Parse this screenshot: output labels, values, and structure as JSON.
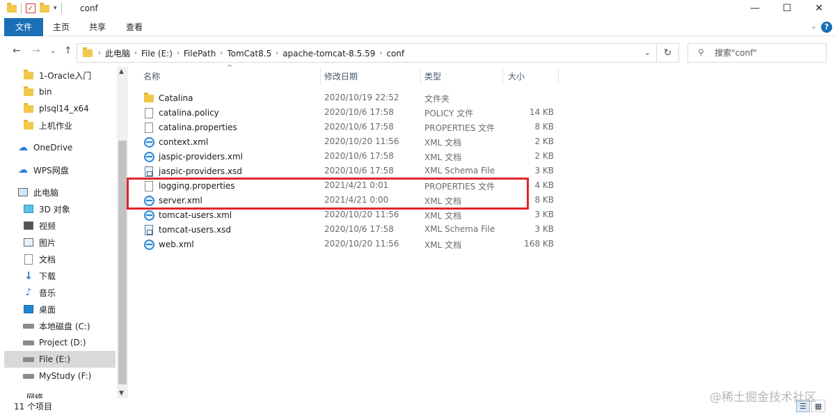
{
  "window": {
    "title": "conf",
    "minimize_glyph": "—",
    "maximize_glyph": "☐",
    "close_glyph": "✕"
  },
  "ribbon": {
    "tabs": [
      {
        "label": "文件",
        "active": true
      },
      {
        "label": "主页"
      },
      {
        "label": "共享"
      },
      {
        "label": "查看"
      }
    ],
    "expand_glyph": "⌄",
    "help_glyph": "?"
  },
  "navigation": {
    "back_glyph": "←",
    "forward_glyph": "→",
    "recent_glyph": "⌄",
    "up_glyph": "↑",
    "breadcrumbs": [
      "此电脑",
      "File (E:)",
      "FilePath",
      "TomCat8.5",
      "apache-tomcat-8.5.59",
      "conf"
    ],
    "crumb_separator": "›",
    "dropdown_glyph": "⌄",
    "refresh_glyph": "↻",
    "search_placeholder": "搜索\"conf\"",
    "search_icon_glyph": "⚲"
  },
  "nav_pane": {
    "items": [
      {
        "label": "1-Oracle入门",
        "icon": "folder-icon"
      },
      {
        "label": "bin",
        "icon": "folder-icon"
      },
      {
        "label": "plsql14_x64",
        "icon": "folder-icon"
      },
      {
        "label": "上机作业",
        "icon": "folder-icon"
      },
      {
        "label": "OneDrive",
        "icon": "onedrive-icon"
      },
      {
        "label": "WPS网盘",
        "icon": "wps-cloud-icon"
      },
      {
        "label": "此电脑",
        "icon": "this-pc-icon"
      },
      {
        "label": "3D 对象",
        "icon": "3d-objects-icon"
      },
      {
        "label": "视频",
        "icon": "video-icon"
      },
      {
        "label": "图片",
        "icon": "pictures-icon"
      },
      {
        "label": "文档",
        "icon": "documents-icon"
      },
      {
        "label": "下载",
        "icon": "downloads-icon"
      },
      {
        "label": "音乐",
        "icon": "music-icon"
      },
      {
        "label": "桌面",
        "icon": "desktop-icon"
      },
      {
        "label": "本地磁盘 (C:)",
        "icon": "drive-icon"
      },
      {
        "label": "Project (D:)",
        "icon": "drive-icon"
      },
      {
        "label": "File (E:)",
        "icon": "drive-icon",
        "selected": true
      },
      {
        "label": "MyStudy (F:)",
        "icon": "drive-icon"
      },
      {
        "label": "网络",
        "icon": "network-icon"
      }
    ],
    "scroll_up_glyph": "▲",
    "scroll_down_glyph": "▼"
  },
  "file_list": {
    "columns": {
      "name": "名称",
      "date": "修改日期",
      "type": "类型",
      "size": "大小"
    },
    "sort_glyph": "^",
    "rows": [
      {
        "name": "Catalina",
        "date": "2020/10/19 22:52",
        "type": "文件夹",
        "size": "",
        "icon": "folder-icon"
      },
      {
        "name": "catalina.policy",
        "date": "2020/10/6 17:58",
        "type": "POLICY 文件",
        "size": "14 KB",
        "icon": "file-icon"
      },
      {
        "name": "catalina.properties",
        "date": "2020/10/6 17:58",
        "type": "PROPERTIES 文件",
        "size": "8 KB",
        "icon": "file-icon"
      },
      {
        "name": "context.xml",
        "date": "2020/10/20 11:56",
        "type": "XML 文档",
        "size": "2 KB",
        "icon": "xml-icon"
      },
      {
        "name": "jaspic-providers.xml",
        "date": "2020/10/6 17:58",
        "type": "XML 文档",
        "size": "2 KB",
        "icon": "xml-icon"
      },
      {
        "name": "jaspic-providers.xsd",
        "date": "2020/10/6 17:58",
        "type": "XML Schema File",
        "size": "3 KB",
        "icon": "xsd-icon"
      },
      {
        "name": "logging.properties",
        "date": "2021/4/21 0:01",
        "type": "PROPERTIES 文件",
        "size": "4 KB",
        "icon": "file-icon"
      },
      {
        "name": "server.xml",
        "date": "2021/4/21 0:00",
        "type": "XML 文档",
        "size": "8 KB",
        "icon": "xml-icon"
      },
      {
        "name": "tomcat-users.xml",
        "date": "2020/10/20 11:56",
        "type": "XML 文档",
        "size": "3 KB",
        "icon": "xml-icon"
      },
      {
        "name": "tomcat-users.xsd",
        "date": "2020/10/6 17:58",
        "type": "XML Schema File",
        "size": "3 KB",
        "icon": "xsd-icon"
      },
      {
        "name": "web.xml",
        "date": "2020/10/20 11:56",
        "type": "XML 文档",
        "size": "168 KB",
        "icon": "xml-icon"
      }
    ]
  },
  "status_bar": {
    "item_count": "11 个项目",
    "details_view_glyph": "☰",
    "tiles_view_glyph": "▦"
  },
  "watermark": "@稀土掘金技术社区",
  "colors": {
    "accent": "#1a6fb5",
    "highlight_box": "#e0262c",
    "selected_nav": "#d9d9d9"
  }
}
